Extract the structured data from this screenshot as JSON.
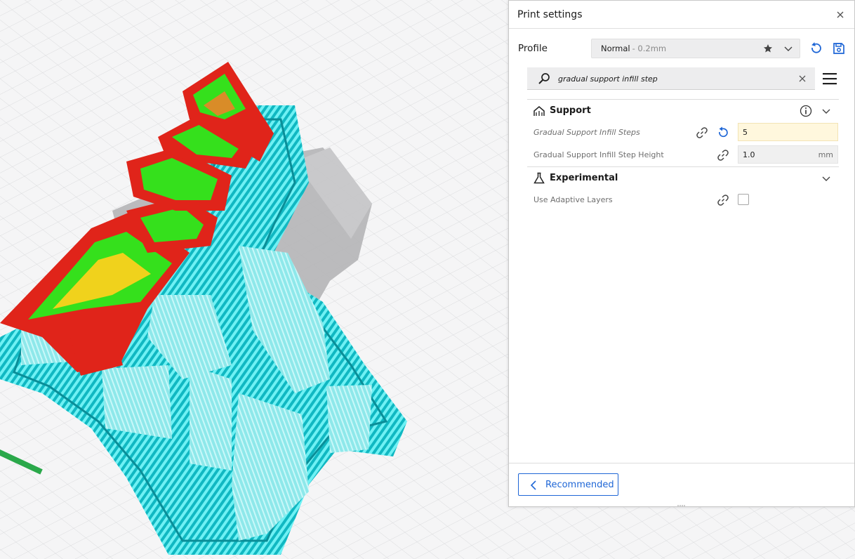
{
  "panel": {
    "title": "Print settings",
    "profile_label": "Profile",
    "profile_value": "Normal",
    "profile_sub": "- 0.2mm"
  },
  "search": {
    "value": "gradual support infill step"
  },
  "sections": {
    "support": {
      "label": "Support",
      "settings": [
        {
          "label": "Gradual Support Infill Steps",
          "value": "5",
          "unit": ""
        },
        {
          "label": "Gradual Support Infill Step Height",
          "value": "1.0",
          "unit": "mm"
        }
      ]
    },
    "experimental": {
      "label": "Experimental",
      "settings": [
        {
          "label": "Use Adaptive Layers",
          "checked": false
        }
      ]
    }
  },
  "footer": {
    "recommended_label": "Recommended"
  },
  "colors": {
    "accent": "#1e66d6",
    "highlight_field": "#fff7dd",
    "model_red": "#f02a1e",
    "model_green": "#35e01c",
    "support_cyan": "#5ee8ee"
  }
}
